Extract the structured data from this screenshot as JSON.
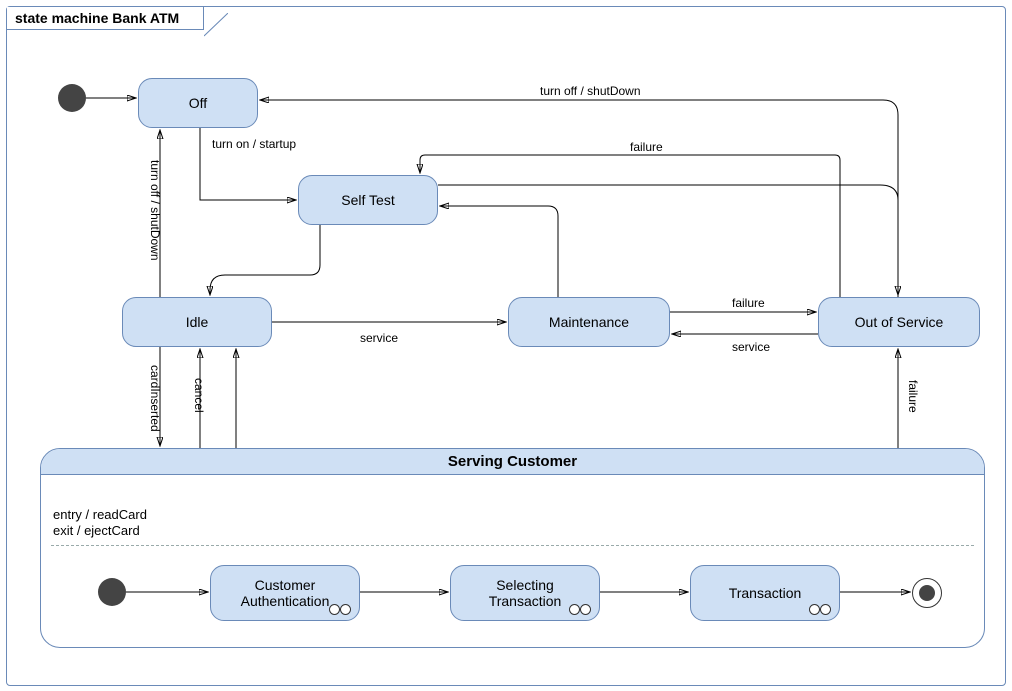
{
  "title": "state machine Bank ATM",
  "states": {
    "off": "Off",
    "selfTest": "Self Test",
    "idle": "Idle",
    "maintenance": "Maintenance",
    "outOfService": "Out of Service"
  },
  "composite": {
    "title": "Serving Customer",
    "entry": "entry / readCard",
    "exit": "exit / ejectCard",
    "inner": {
      "auth": "Customer\nAuthentication",
      "select": "Selecting\nTransaction",
      "txn": "Transaction"
    }
  },
  "transitions": {
    "turnOffShutDown": "turn off / shutDown",
    "turnOnStartup": "turn on / startup",
    "failure": "failure",
    "service": "service",
    "cancel": "cancel",
    "cardInserted": "cardInserted"
  }
}
